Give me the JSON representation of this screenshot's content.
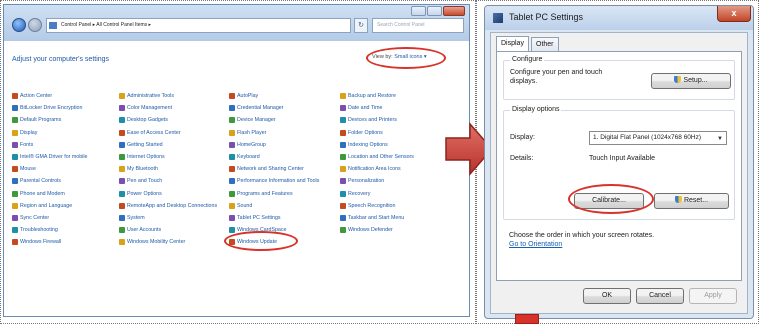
{
  "control_panel": {
    "address": "Control Panel ▸ All Control Panel Items ▸",
    "search_placeholder": "Search Control Panel",
    "heading": "Adjust your computer's settings",
    "view_by_label": "View by:",
    "view_by_value": "Small icons ▾",
    "columns": [
      [
        "Action Center",
        "BitLocker Drive Encryption",
        "Default Programs",
        "Display",
        "Fonts",
        "Intel® GMA Driver for mobile",
        "Mouse",
        "Parental Controls",
        "Phone and Modem",
        "Region and Language",
        "Sync Center",
        "Troubleshooting",
        "Windows Firewall"
      ],
      [
        "Administrative Tools",
        "Color Management",
        "Desktop Gadgets",
        "Ease of Access Center",
        "Getting Started",
        "Internet Options",
        "My Bluetooth",
        "Pen and Touch",
        "Power Options",
        "RemoteApp and Desktop Connections",
        "System",
        "User Accounts",
        "Windows Mobility Center"
      ],
      [
        "AutoPlay",
        "Credential Manager",
        "Device Manager",
        "Flash Player",
        "HomeGroup",
        "Keyboard",
        "Network and Sharing Center",
        "Performance Information and Tools",
        "Programs and Features",
        "Sound",
        "Tablet PC Settings",
        "Windows CardSpace",
        "Windows Update"
      ],
      [
        "Backup and Restore",
        "Date and Time",
        "Devices and Printers",
        "Folder Options",
        "Indexing Options",
        "Location and Other Sensors",
        "Notification Area Icons",
        "Personalization",
        "Recovery",
        "Speech Recognition",
        "Taskbar and Start Menu",
        "Windows Defender"
      ]
    ],
    "icon_colors": [
      "#c44a1f",
      "#2f6fbf",
      "#3c9a3c",
      "#d9a21b",
      "#7b4fb0",
      "#1f8fa8"
    ]
  },
  "dialog": {
    "title": "Tablet PC Settings",
    "close_label": "x",
    "tabs": [
      "Display",
      "Other"
    ],
    "configure_title": "Configure",
    "configure_text_1": "Configure your pen and touch",
    "configure_text_2": "displays.",
    "setup_label": "Setup...",
    "options_title": "Display options",
    "display_label": "Display:",
    "display_value": "1. Digital Flat Panel (1024x768 60Hz)",
    "details_label": "Details:",
    "details_value": "Touch Input Available",
    "calibrate_label": "Calibrate...",
    "reset_label": "Reset...",
    "orientation_text": "Choose the order in which your screen rotates.",
    "orientation_link": "Go to Orientation",
    "ok_label": "OK",
    "cancel_label": "Cancel",
    "apply_label": "Apply"
  },
  "highlight_color": "#d8332a"
}
